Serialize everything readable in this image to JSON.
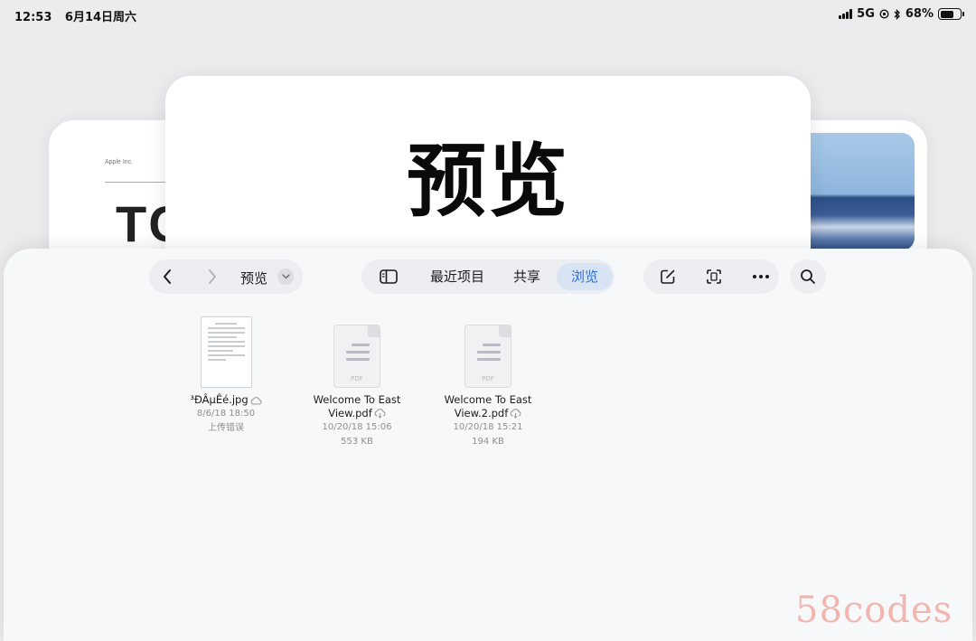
{
  "status_bar": {
    "time": "12:53",
    "date": "6月14日周六",
    "network": "5G",
    "battery_percent": "68%",
    "battery_level": 0.68
  },
  "background_apps": {
    "left_card": {
      "company": "Apple Inc.",
      "heading": "TC"
    },
    "center_card": {
      "title": "预览"
    }
  },
  "files_window": {
    "location": "预览",
    "tabs": [
      {
        "label": "最近项目",
        "selected": false
      },
      {
        "label": "共享",
        "selected": false
      },
      {
        "label": "浏览",
        "selected": true
      }
    ],
    "accent_color": "#2f6fd1",
    "files": [
      {
        "name": "³ÐÂµÊé.jpg",
        "line1": "8/6/18 18:50",
        "line2": "上传错误",
        "icon": "image-thumbnail"
      },
      {
        "name": "Welcome To East View.pdf",
        "line1": "10/20/18 15:06",
        "line2": "553 KB",
        "icon": "pdf-icon",
        "type_tag": "PDF"
      },
      {
        "name": "Welcome To East View.2.pdf",
        "line1": "10/20/18 15:21",
        "line2": "194 KB",
        "icon": "pdf-icon",
        "type_tag": "PDF"
      }
    ]
  },
  "watermark": "58codes"
}
